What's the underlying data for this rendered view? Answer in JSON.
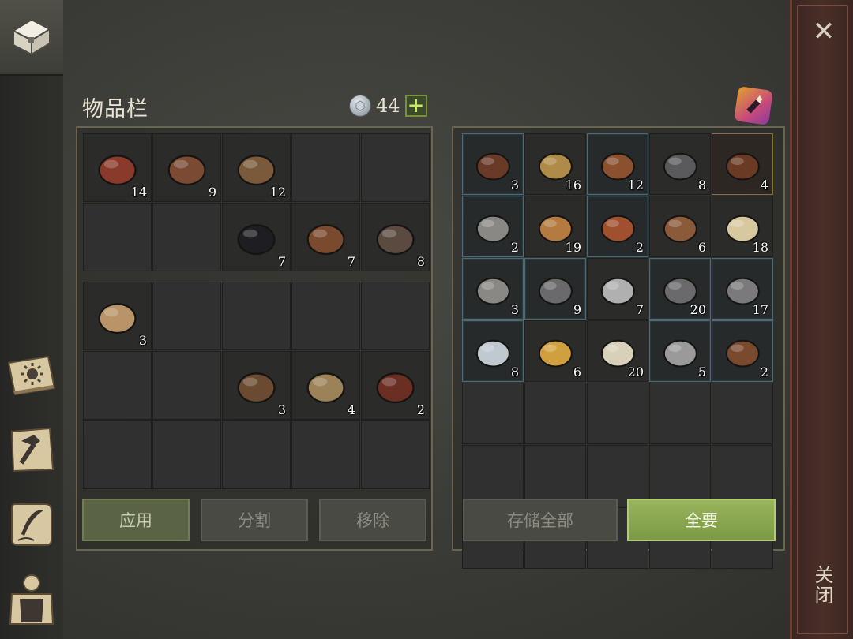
{
  "header": {
    "title": "物品栏",
    "currency_value": "44",
    "plus_label": "+"
  },
  "close_bar": {
    "close_glyph": "✕",
    "label": "关闭"
  },
  "buttons": {
    "apply": "应用",
    "split": "分割",
    "remove": "移除",
    "store_all": "存储全部",
    "take_all": "全要"
  },
  "sidebar": {
    "items": [
      {
        "icon": "chest-icon"
      },
      {
        "icon": "sun-book-icon"
      },
      {
        "icon": "crafting-hammer-icon"
      },
      {
        "icon": "quest-scroll-icon"
      },
      {
        "icon": "character-icon"
      }
    ]
  },
  "inventory": {
    "section1": [
      {
        "icon": "meat-steak-icon",
        "qty": "14",
        "color": "#8a3a2a"
      },
      {
        "icon": "leather-flask-icon",
        "qty": "9",
        "color": "#7a4a32"
      },
      {
        "icon": "fiber-icon",
        "qty": "12",
        "color": "#7a5a3a"
      },
      null,
      null,
      null,
      null,
      {
        "icon": "coal-icon",
        "qty": "7",
        "color": "#1e1e22"
      },
      {
        "icon": "leather-scrap-icon",
        "qty": "7",
        "color": "#7a4a2e"
      },
      {
        "icon": "wire-coil-icon",
        "qty": "8",
        "color": "#5a4a40"
      }
    ],
    "section2": [
      {
        "icon": "cloth-bolt-icon",
        "qty": "3",
        "color": "#b89468"
      },
      null,
      null,
      null,
      null,
      null,
      null,
      {
        "icon": "nails-icon",
        "qty": "3",
        "color": "#6a4a30"
      },
      {
        "icon": "rope-icon",
        "qty": "4",
        "color": "#9c8258"
      },
      {
        "icon": "leather-pouch-icon",
        "qty": "2",
        "color": "#6a2e22"
      },
      null,
      null,
      null,
      null,
      null
    ]
  },
  "storage": {
    "items": [
      {
        "icon": "saddle-icon",
        "qty": "3",
        "color": "#6a3a28",
        "frame": "blue"
      },
      {
        "icon": "goblet-icon",
        "qty": "16",
        "color": "#b08a48",
        "frame": "none"
      },
      {
        "icon": "collar-icon",
        "qty": "12",
        "color": "#8a5030",
        "frame": "blue"
      },
      {
        "icon": "gears-icon",
        "qty": "8",
        "color": "#5a5a5c",
        "frame": "none"
      },
      {
        "icon": "bridle-icon",
        "qty": "4",
        "color": "#6a3a24",
        "frame": "gold"
      },
      {
        "icon": "horseshoe-icon",
        "qty": "2",
        "color": "#8a8884",
        "frame": "blue"
      },
      {
        "icon": "hourglass-icon",
        "qty": "19",
        "color": "#b47a40",
        "frame": "none"
      },
      {
        "icon": "copper-gourd-icon",
        "qty": "2",
        "color": "#a0502e",
        "frame": "blue"
      },
      {
        "icon": "padlock-icon",
        "qty": "6",
        "color": "#8a5a3a",
        "frame": "none"
      },
      {
        "icon": "comb-icon",
        "qty": "18",
        "color": "#d8c8a0",
        "frame": "none"
      },
      {
        "icon": "crank-icon",
        "qty": "3",
        "color": "#8a8884",
        "frame": "blue"
      },
      {
        "icon": "ornate-blade-icon",
        "qty": "9",
        "color": "#6a6a6c",
        "frame": "blue"
      },
      {
        "icon": "spoon-icon",
        "qty": "7",
        "color": "#b0b0b0",
        "frame": "none"
      },
      {
        "icon": "jeweled-blade-icon",
        "qty": "20",
        "color": "#6a6a6c",
        "frame": "blue"
      },
      {
        "icon": "shackles-icon",
        "qty": "17",
        "color": "#7a7a7c",
        "frame": "blue"
      },
      {
        "icon": "mirror-icon",
        "qty": "8",
        "color": "#c0c8d0",
        "frame": "blue"
      },
      {
        "icon": "gold-ring-icon",
        "qty": "6",
        "color": "#d0a040",
        "frame": "none"
      },
      {
        "icon": "skull-icon",
        "qty": "20",
        "color": "#d8d0b8",
        "frame": "none"
      },
      {
        "icon": "pliers-icon",
        "qty": "5",
        "color": "#9a9a9a",
        "frame": "blue"
      },
      {
        "icon": "wheel-icon",
        "qty": "2",
        "color": "#7a4a2e",
        "frame": "blue"
      },
      null,
      null,
      null,
      null,
      null,
      null,
      null,
      null,
      null,
      null,
      null,
      null,
      null,
      null,
      null
    ]
  }
}
